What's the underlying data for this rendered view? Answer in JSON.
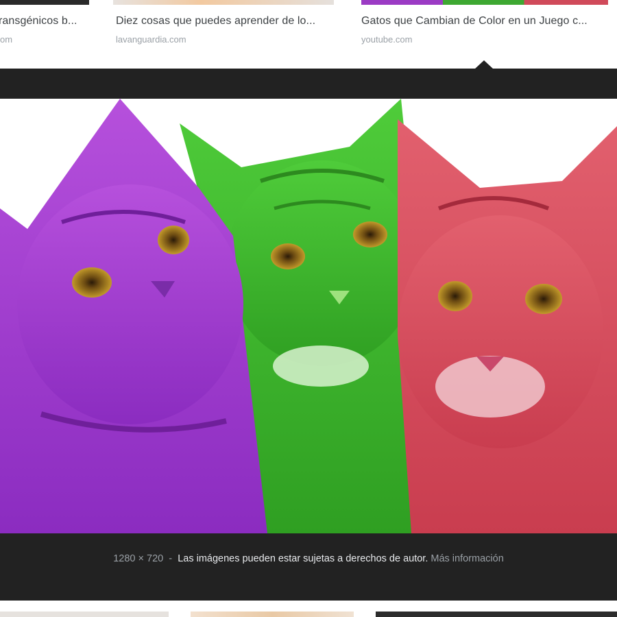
{
  "results_top": [
    {
      "title": "ransgénicos b...",
      "source": "om"
    },
    {
      "title": "Diez cosas que puedes aprender de lo...",
      "source": "lavanguardia.com"
    },
    {
      "title": "Gatos que Cambian de Color en un Juego c...",
      "source": "youtube.com"
    }
  ],
  "preview": {
    "dimensions": "1280 × 720",
    "separator": "-",
    "copyright": "Las imágenes pueden estar sujetas a derechos de autor.",
    "more_info": "Más información"
  },
  "colors": {
    "panel_bg": "#222222",
    "cat_purple": "#a23cd0",
    "cat_green": "#3bbf2a",
    "cat_red": "#d8495a"
  }
}
